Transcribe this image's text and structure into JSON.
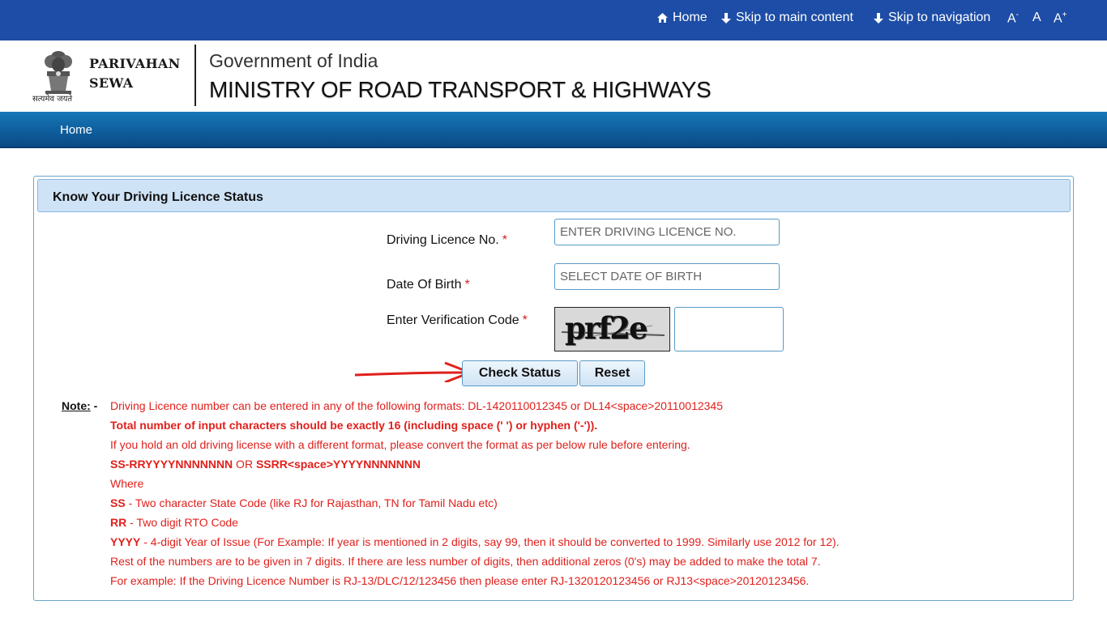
{
  "topbar": {
    "home": "Home",
    "skip_main": "Skip to main content",
    "skip_nav": "Skip to navigation",
    "font_small": "A",
    "font_small_sup": "-",
    "font_normal": "A",
    "font_large": "A",
    "font_large_sup": "+"
  },
  "header": {
    "brand_line1": "PARIVAHAN",
    "brand_line2": "SEWA",
    "emblem_motto": "सत्यमेव जयते",
    "gov": "Government of India",
    "ministry": "MINISTRY OF ROAD TRANSPORT & HIGHWAYS"
  },
  "nav": {
    "home": "Home"
  },
  "form": {
    "title": "Know Your Driving Licence Status",
    "dl_label": "Driving Licence No.",
    "dl_placeholder": "ENTER DRIVING LICENCE NO.",
    "dob_label": "Date Of Birth",
    "dob_placeholder": "SELECT DATE OF BIRTH",
    "captcha_label": "Enter Verification Code",
    "captcha_text": "prf2e",
    "required_mark": "*",
    "check_button": "Check Status",
    "reset_button": "Reset"
  },
  "note": {
    "label": "Note:",
    "dash": "-",
    "line1": "Driving Licence number can be entered in any of the following formats: DL-1420110012345 or DL14<space>20110012345",
    "line2": "Total number of input characters should be exactly 16 (including space (' ') or hyphen ('-')).",
    "line3": "If you hold an old driving license with a different format, please convert the format as per below rule before entering.",
    "line4_a": "SS-RRYYYYNNNNNNN",
    "line4_b": " OR ",
    "line4_c": "SSRR<space>YYYYNNNNNNN",
    "line5": "Where",
    "line6_key": "SS",
    "line6_text": " - Two character State Code (like RJ for Rajasthan, TN for Tamil Nadu etc)",
    "line7_key": "RR",
    "line7_text": " - Two digit RTO Code",
    "line8_key": "YYYY",
    "line8_text": " - 4-digit Year of Issue (For Example: If year is mentioned in 2 digits, say 99, then it should be converted to 1999. Similarly use 2012 for 12).",
    "line9": "Rest of the numbers are to be given in 7 digits. If there are less number of digits, then additional zeros (0's) may be added to make the total 7.",
    "line10": "For example: If the Driving Licence Number is RJ-13/DLC/12/123456 then please enter RJ-1320120123456 or RJ13<space>20120123456."
  },
  "colors": {
    "topbar": "#1d4da6",
    "navbar": "#0e5d9e",
    "panel_header": "#cfe3f7",
    "note_text": "#e0201c",
    "arrow": "#e0201c"
  }
}
